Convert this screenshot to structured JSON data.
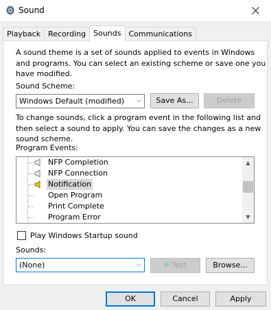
{
  "window": {
    "title": "Sound"
  },
  "tabs": [
    {
      "label": "Playback"
    },
    {
      "label": "Recording"
    },
    {
      "label": "Sounds"
    },
    {
      "label": "Communications"
    }
  ],
  "active_tab": "Sounds",
  "intro_lines": [
    "A sound theme is a set of sounds applied to events in Windows",
    "and programs.  You can select an existing scheme or save one you",
    "have modified."
  ],
  "scheme": {
    "label": "Sound Scheme:",
    "value": "Windows Default (modified)",
    "save_as_label": "Save As...",
    "delete_label": "Delete"
  },
  "change_lines": [
    "To change sounds, click a program event in the following list and",
    "then select a sound to apply.  You can save the changes as a new",
    "sound scheme."
  ],
  "events": {
    "label": "Program Events:",
    "items": [
      {
        "label": "NFP Completion",
        "has_sound": true,
        "selected": false
      },
      {
        "label": "NFP Connection",
        "has_sound": true,
        "selected": false
      },
      {
        "label": "Notification",
        "has_sound": true,
        "selected": true
      },
      {
        "label": "Open Program",
        "has_sound": false,
        "selected": false
      },
      {
        "label": "Print Complete",
        "has_sound": false,
        "selected": false
      },
      {
        "label": "Program Error",
        "has_sound": false,
        "selected": false
      }
    ]
  },
  "startup": {
    "label": "Play Windows Startup sound",
    "checked": false
  },
  "sounds": {
    "label": "Sounds:",
    "value": "(None)",
    "test_label": "Test",
    "browse_label": "Browse..."
  },
  "footer": {
    "ok_label": "OK",
    "cancel_label": "Cancel",
    "apply_label": "Apply"
  },
  "colors": {
    "accent": "#0078d7",
    "speaker_active": "#e8c800"
  }
}
